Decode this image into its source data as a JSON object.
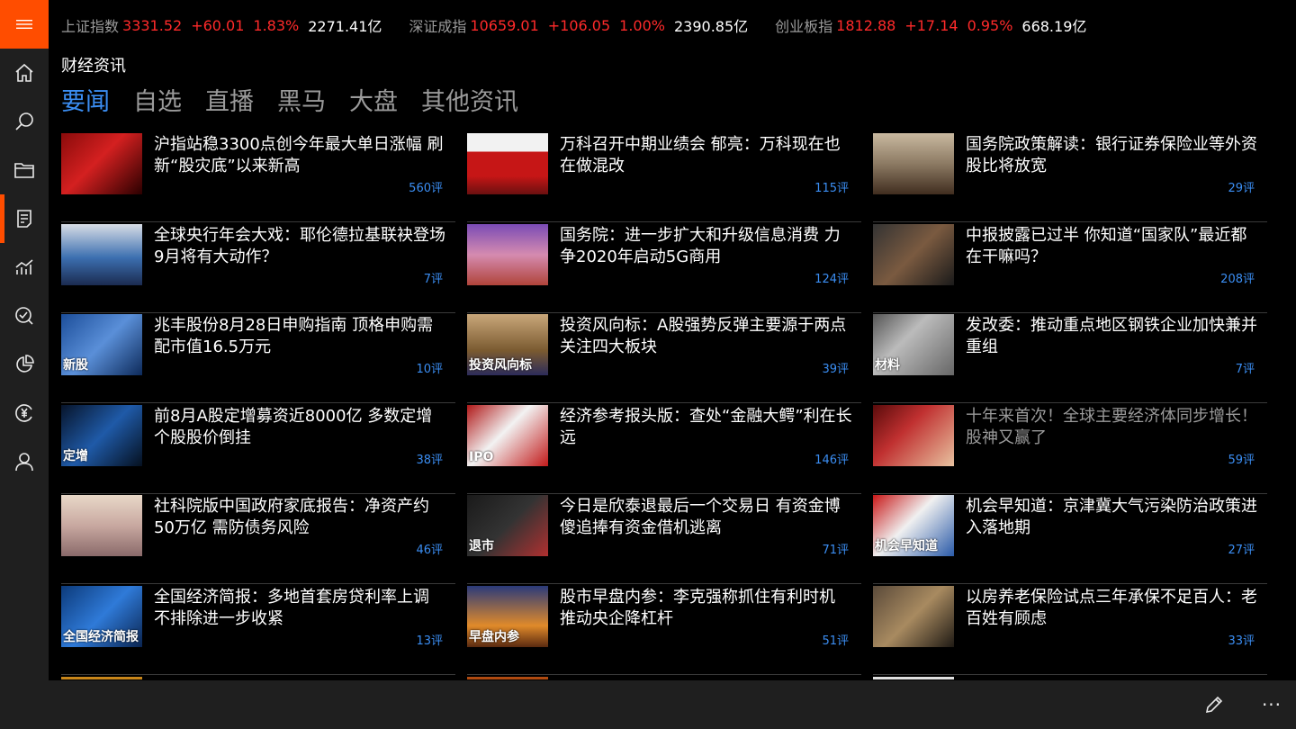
{
  "colors": {
    "accent": "#ff4d00",
    "link_blue": "#3b8ef3",
    "up_red": "#ff2a2a",
    "rail_bg": "#1f1f1f"
  },
  "rail": {
    "menu_icon": "hamburger-icon",
    "items": [
      {
        "icon": "home-icon"
      },
      {
        "icon": "search-icon"
      },
      {
        "icon": "folder-icon"
      },
      {
        "icon": "news-icon",
        "active": true
      },
      {
        "icon": "chart-icon"
      },
      {
        "icon": "stock-search-icon"
      },
      {
        "icon": "pie-chart-icon"
      },
      {
        "icon": "yen-coin-icon"
      },
      {
        "icon": "user-icon"
      }
    ]
  },
  "ticker": [
    {
      "name": "上证指数",
      "value": "3331.52",
      "change": "+60.01",
      "pct": "1.83%",
      "amount": "2271.41亿"
    },
    {
      "name": "深证成指",
      "value": "10659.01",
      "change": "+106.05",
      "pct": "1.00%",
      "amount": "2390.85亿"
    },
    {
      "name": "创业板指",
      "value": "1812.88",
      "change": "+17.14",
      "pct": "0.95%",
      "amount": "668.19亿"
    }
  ],
  "section_title": "财经资讯",
  "tabs": [
    "要闻",
    "自选",
    "直播",
    "黑马",
    "大盘",
    "其他资讯"
  ],
  "news": [
    {
      "title": "沪指站稳3300点创今年最大单日涨幅 刷新“股灾底”以来新高",
      "comments": "560评",
      "caption": ""
    },
    {
      "title": "万科召开中期业绩会 郁亮：万科现在也在做混改",
      "comments": "115评",
      "caption": ""
    },
    {
      "title": "国务院政策解读：银行证券保险业等外资股比将放宽",
      "comments": "29评",
      "caption": ""
    },
    {
      "title": "全球央行年会大戏：耶伦德拉基联袂登场 9月将有大动作？",
      "comments": "7评",
      "caption": ""
    },
    {
      "title": "国务院：进一步扩大和升级信息消费 力争2020年启动5G商用",
      "comments": "124评",
      "caption": ""
    },
    {
      "title": "中报披露已过半 你知道“国家队”最近都在干嘛吗？",
      "comments": "208评",
      "caption": ""
    },
    {
      "title": "兆丰股份8月28日申购指南 顶格申购需配市值16.5万元",
      "comments": "10评",
      "caption": "新股"
    },
    {
      "title": "投资风向标：A股强势反弹主要源于两点 关注四大板块",
      "comments": "39评",
      "caption": "投资风向标"
    },
    {
      "title": "发改委：推动重点地区钢铁企业加快兼并重组",
      "comments": "7评",
      "caption": "材料"
    },
    {
      "title": "前8月A股定增募资近8000亿 多数定增个股股价倒挂",
      "comments": "38评",
      "caption": "定增"
    },
    {
      "title": "经济参考报头版：查处“金融大鳄”利在长远",
      "comments": "146评",
      "caption": "IPO"
    },
    {
      "title": "十年来首次！全球主要经济体同步增长！股神又赢了",
      "comments": "59评",
      "caption": "",
      "read": true
    },
    {
      "title": "社科院版中国政府家底报告：净资产约50万亿 需防债务风险",
      "comments": "46评",
      "caption": ""
    },
    {
      "title": "今日是欣泰退最后一个交易日 有资金博傻追捧有资金借机逃离",
      "comments": "71评",
      "caption": "退市"
    },
    {
      "title": "机会早知道：京津冀大气污染防治政策进入落地期",
      "comments": "27评",
      "caption": "机会早知道"
    },
    {
      "title": "全国经济简报：多地首套房贷利率上调 不排除进一步收紧",
      "comments": "13评",
      "caption": "全国经济简报"
    },
    {
      "title": "股市早盘内参：李克强称抓住有利时机 推动央企降杠杆",
      "comments": "51评",
      "caption": "早盘内参"
    },
    {
      "title": "以房养老保险试点三年承保不足百人：老百姓有顾虑",
      "comments": "33评",
      "caption": ""
    }
  ],
  "appbar": {
    "edit_icon": "pencil-icon",
    "more_icon": "more-icon",
    "more_label": "···"
  }
}
